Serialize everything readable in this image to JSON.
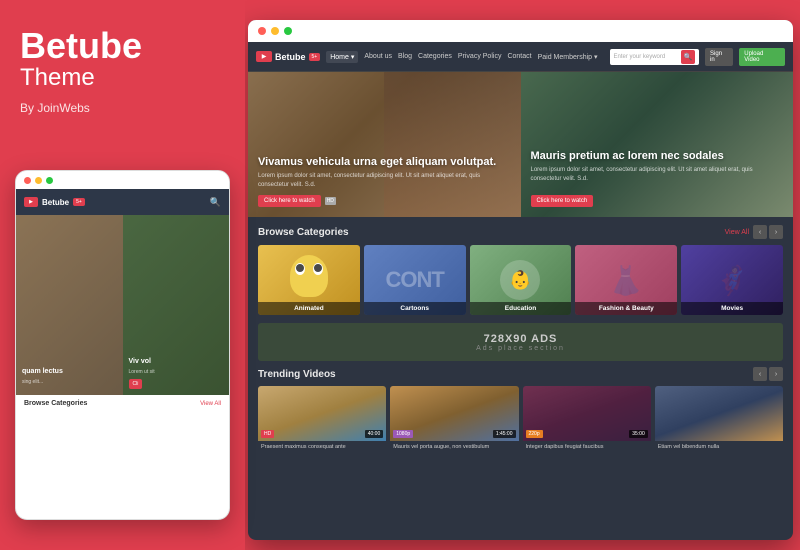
{
  "left_panel": {
    "brand": "Betube",
    "theme": "Theme",
    "by": "By JoinWebs"
  },
  "mobile_mockup": {
    "logo": "Betube",
    "badge": "5+",
    "hero_left_title": "quam lectus",
    "hero_left_sub": "sing elit...",
    "hero_right_title": "Viv vol",
    "hero_right_sub": "Lorem\nut sit",
    "hero_btn": "Cli",
    "browse_categories": "Browse Categories",
    "view_all": "View All"
  },
  "desktop": {
    "top_dots": [
      "red",
      "yellow",
      "green"
    ],
    "nav": {
      "logo": "Betube",
      "badge": "5+",
      "links": [
        "Home",
        "About us",
        "Blog",
        "Categories",
        "Privacy Policy",
        "Contact",
        "Paid Membership"
      ],
      "search_placeholder": "Enter your keyword",
      "signin": "Sign in",
      "upload": "Upload Video"
    },
    "hero": {
      "left": {
        "title": "Vivamus vehicula urna eget aliquam volutpat.",
        "desc": "Lorem ipsum dolor sit amet, consectetur adipiscing elit. Ut sit amet aliquet erat, quis consectetur velit. S.d.",
        "btn": "Click here to watch",
        "badge": "HD"
      },
      "right": {
        "title": "Mauris pretium ac lorem nec sodales",
        "desc": "Lorem ipsum dolor sit amet, consectetur adipiscing elit. Ut sit amet aliquet erat, quis consectetur velit. S.d.",
        "btn": "Click here to watch"
      }
    },
    "browse_categories": {
      "title": "Browse Categories",
      "view_all": "View All",
      "categories": [
        {
          "label": "Animated",
          "color": "#f0c060"
        },
        {
          "label": "Cartoons",
          "color": "#6080c0"
        },
        {
          "label": "Education",
          "color": "#80c080"
        },
        {
          "label": "Fashion & Beauty",
          "color": "#c06080"
        },
        {
          "label": "Movies",
          "color": "#8060a0"
        }
      ]
    },
    "ads": {
      "title": "728X90 ADS",
      "subtitle": "Ads place section"
    },
    "trending": {
      "title": "Trending Videos",
      "videos": [
        {
          "title": "Praesent maximus consequat ante",
          "badge": "HD",
          "duration": "40:00"
        },
        {
          "title": "Mauris vel porta augue, non vestibulum",
          "badge": "1080p",
          "duration": "1:45:00"
        },
        {
          "title": "Integer dapibus feugiat faucibus",
          "badge": "220p",
          "duration": "35:00"
        },
        {
          "title": "Etiam vel bibendum nulla",
          "badge": "",
          "duration": ""
        }
      ]
    }
  }
}
